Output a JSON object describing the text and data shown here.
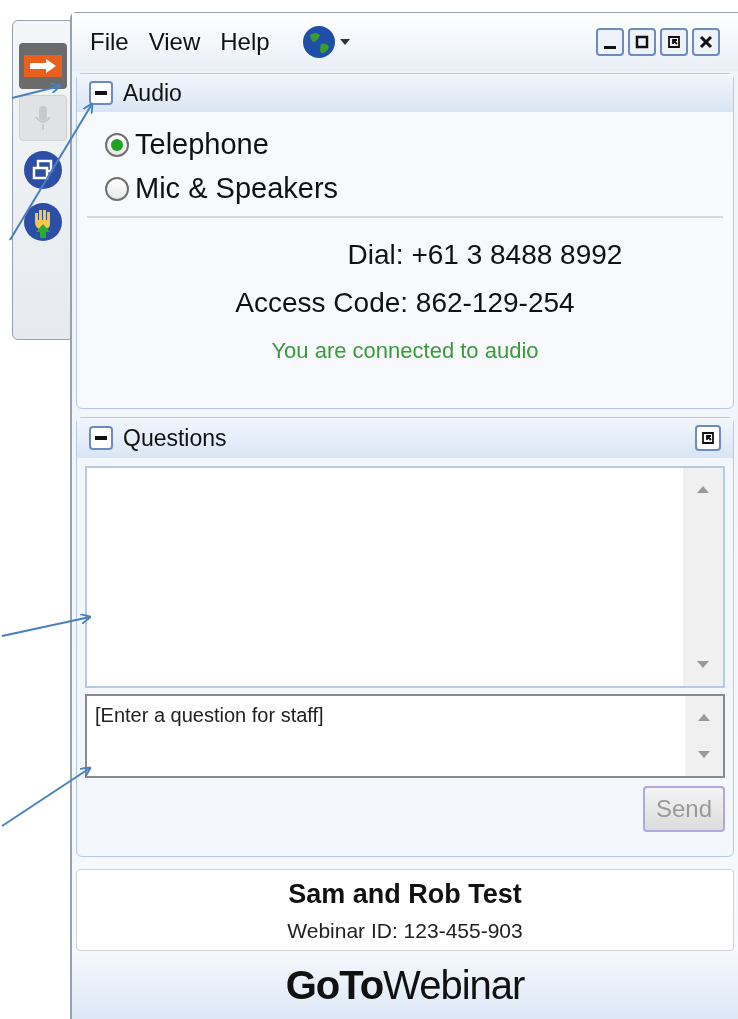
{
  "toolbar": {
    "buttons": [
      {
        "kind": "arrow",
        "disabled": false
      },
      {
        "kind": "mic",
        "disabled": true
      },
      {
        "kind": "windows",
        "disabled": false
      },
      {
        "kind": "hand",
        "disabled": false
      }
    ]
  },
  "menu": [
    "File",
    "View",
    "Help"
  ],
  "audio": {
    "title": "Audio",
    "expanded": true,
    "options": [
      {
        "label": "Telephone",
        "selected": true
      },
      {
        "label": "Mic & Speakers",
        "selected": false
      }
    ],
    "dial": "Dial: +61 3 8488 8992",
    "access_code": "Access Code: 862-129-254",
    "status": "You are connected to audio"
  },
  "questions": {
    "title": "Questions",
    "expanded": true,
    "placeholder": "[Enter a question for staff]",
    "send": "Send"
  },
  "webinar": {
    "title": "Sam and Rob Test",
    "id": "Webinar ID: 123-455-903"
  },
  "logo": "**GoTo**Webinar"
}
